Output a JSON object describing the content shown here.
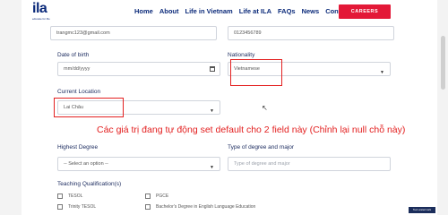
{
  "header": {
    "logo_text": "ila",
    "logo_tagline": "educate for life",
    "nav": [
      "Home",
      "About",
      "Life in Vietnam",
      "Life at ILA",
      "FAQs",
      "News",
      "Contact"
    ],
    "careers_label": "CAREERS"
  },
  "form": {
    "email_value": "trangmc123@gmail.com",
    "phone_value": "0123456789",
    "dob_label": "Date of birth",
    "dob_placeholder": "mm/dd/yyyy",
    "nationality_label": "Nationality",
    "nationality_value": "Vietnamese",
    "location_label": "Current Location",
    "location_value": "Lai Châu",
    "degree_label": "Highest Degree",
    "degree_value": "-- Select an option --",
    "degree_type_label": "Type of degree and major",
    "degree_type_placeholder": "Type of degree and major",
    "quals_label": "Teaching Qualification(s)",
    "quals": [
      {
        "label": "TESOL"
      },
      {
        "label": "PGCE"
      },
      {
        "label": "Trinity TESOL"
      },
      {
        "label": "Bachelor's Degree in English Language Education"
      }
    ]
  },
  "annotation": "Các giá trị đang tự động set default cho 2 field này (Chỉnh lại null chỗ này)",
  "toast_text": "Text watermark"
}
